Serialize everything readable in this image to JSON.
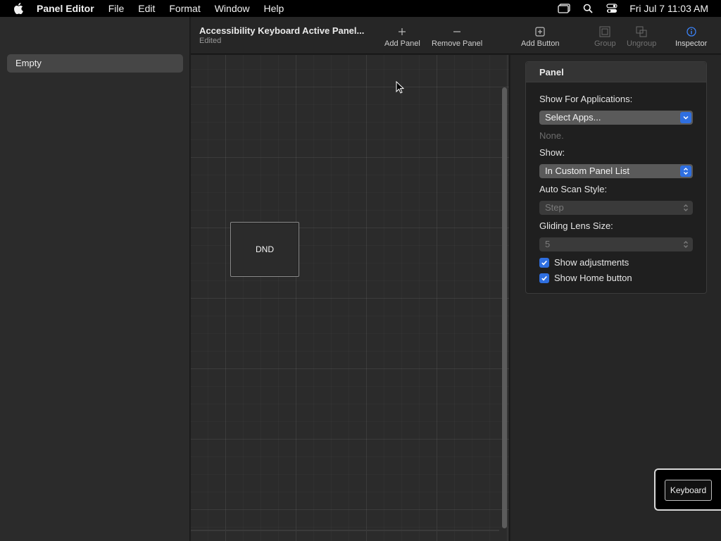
{
  "menubar": {
    "app_name": "Panel Editor",
    "menus": [
      "File",
      "Edit",
      "Format",
      "Window",
      "Help"
    ],
    "clock": "Fri Jul 7  11:03 AM"
  },
  "sidebar": {
    "items": [
      {
        "label": "Empty"
      }
    ]
  },
  "toolbar": {
    "title": "Accessibility Keyboard Active Panel...",
    "subtitle": "Edited",
    "add_panel": "Add Panel",
    "remove_panel": "Remove Panel",
    "add_button": "Add Button",
    "group": "Group",
    "ungroup": "Ungroup",
    "inspector": "Inspector"
  },
  "canvas": {
    "button_label": "DND"
  },
  "inspector": {
    "header": "Panel",
    "show_for_apps_label": "Show For Applications:",
    "select_apps_value": "Select Apps...",
    "none_note": "None.",
    "show_label": "Show:",
    "show_value": "In Custom Panel List",
    "auto_scan_label": "Auto Scan Style:",
    "auto_scan_value": "Step",
    "gliding_lens_label": "Gliding Lens Size:",
    "gliding_lens_value": "5",
    "show_adjustments": "Show adjustments",
    "show_home_button": "Show Home button"
  },
  "keyboard": {
    "label": "Keyboard"
  },
  "colors": {
    "accent": "#2f6fe0",
    "menubar_bg": "#000000",
    "sidebar_bg": "#2b2b2b"
  }
}
